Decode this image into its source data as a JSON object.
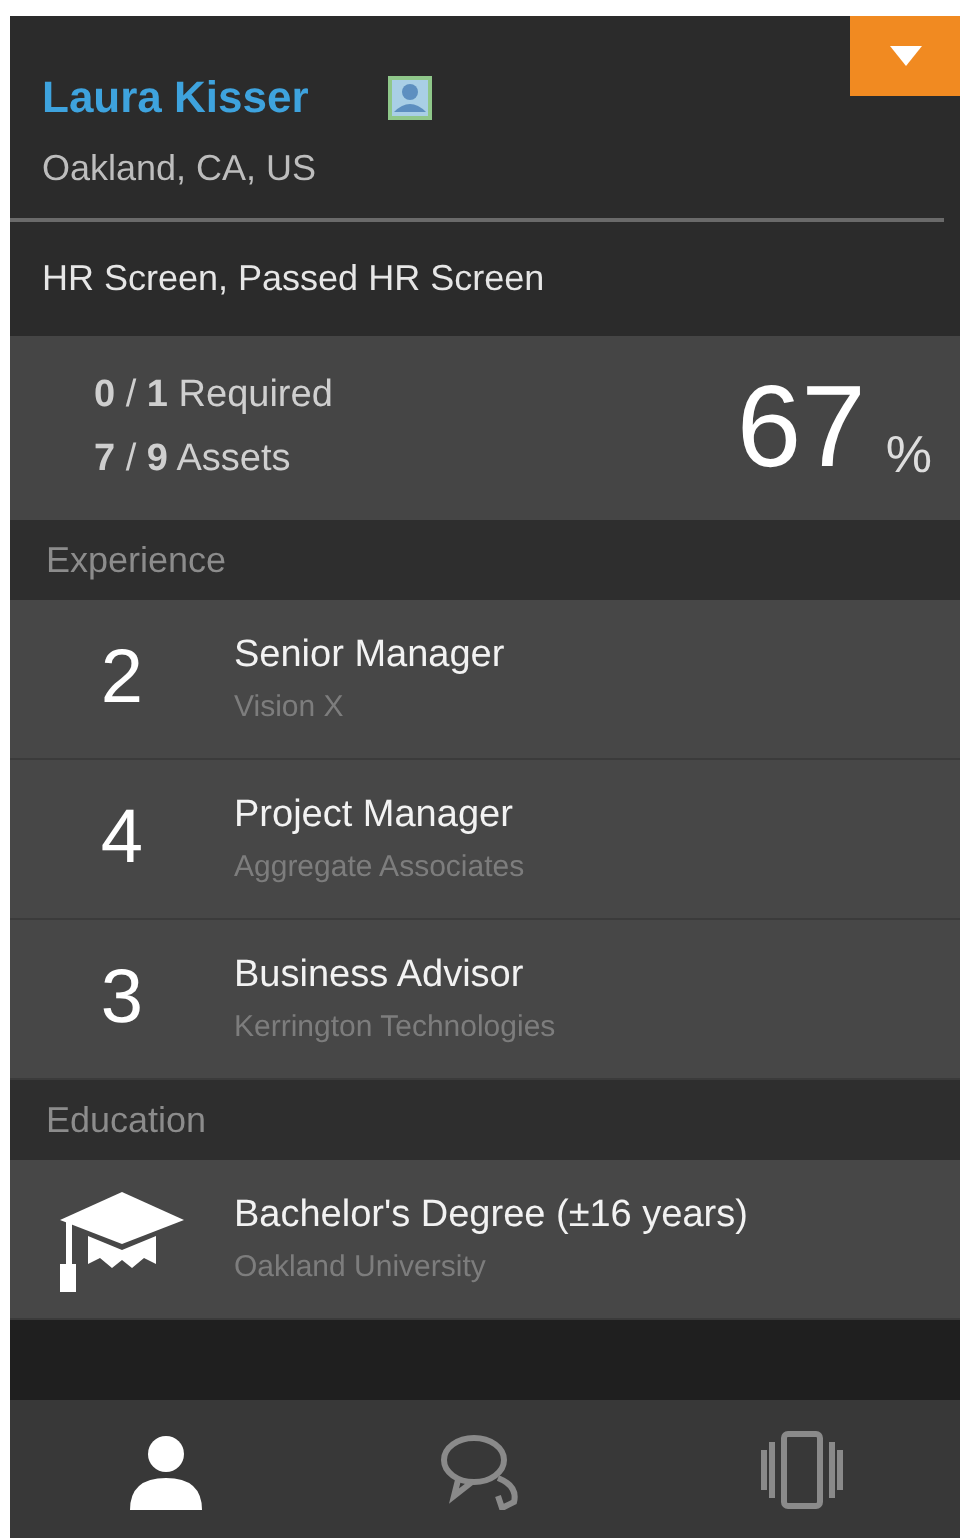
{
  "profile": {
    "name": "Laura Kisser",
    "location": "Oakland, CA, US"
  },
  "status": "HR Screen, Passed HR Screen",
  "stats": {
    "items": [
      {
        "done": "0",
        "sep": "/",
        "total": "1",
        "label": "Required"
      },
      {
        "done": "7",
        "sep": "/",
        "total": "9",
        "label": "Assets"
      }
    ],
    "percent": "67",
    "percent_sign": "%"
  },
  "experience": {
    "title": "Experience",
    "items": [
      {
        "years": "2",
        "role": "Senior Manager",
        "company": "Vision X"
      },
      {
        "years": "4",
        "role": "Project Manager",
        "company": "Aggregate Associates"
      },
      {
        "years": "3",
        "role": "Business Advisor",
        "company": "Kerrington Technologies"
      }
    ]
  },
  "education": {
    "title": "Education",
    "items": [
      {
        "degree": "Bachelor's Degree (±16 years)",
        "school": "Oakland University"
      }
    ]
  },
  "tabs": [
    {
      "kind": "profile",
      "selected": true
    },
    {
      "kind": "chat",
      "selected": false
    },
    {
      "kind": "cards",
      "selected": false
    }
  ]
}
